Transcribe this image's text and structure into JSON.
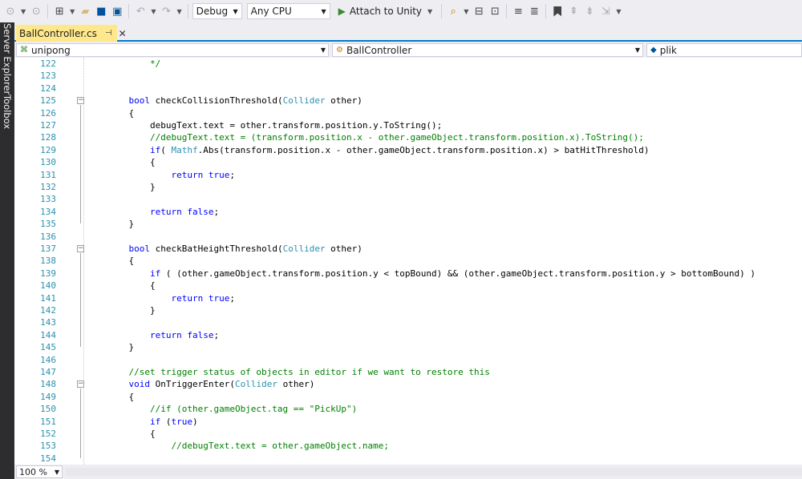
{
  "toolbar": {
    "back_icon": "back-arrow-icon",
    "config": "Debug",
    "platform": "Any CPU",
    "attach_label": "Attach to Unity"
  },
  "sidebar": {
    "server_explorer": "Server Explorer",
    "toolbox": "Toolbox"
  },
  "tab": {
    "title": "BallController.cs",
    "pin": "⊣",
    "close": "✕"
  },
  "nav": {
    "project": "unipong",
    "class": "BallController",
    "member": "plik"
  },
  "zoom": "100 %",
  "colors": {
    "keyword": "#0000ff",
    "type": "#2b91af",
    "comment": "#008000",
    "string": "#a31515",
    "line_number": "#2b91af",
    "active_tab": "#ffe88c",
    "accent": "#007acc"
  },
  "code_lines": [
    {
      "n": "122",
      "tokens": [
        [
          "        */",
          "c"
        ]
      ]
    },
    {
      "n": "123",
      "tokens": []
    },
    {
      "n": "124",
      "tokens": []
    },
    {
      "n": "125",
      "fold": "−",
      "tokens": [
        [
          "    ",
          ""
        ],
        [
          "bool",
          "k"
        ],
        [
          " checkCollisionThreshold(",
          ""
        ],
        [
          "Collider",
          "t"
        ],
        [
          " other)",
          ""
        ]
      ]
    },
    {
      "n": "126",
      "tokens": [
        [
          "    {",
          ""
        ]
      ]
    },
    {
      "n": "127",
      "tokens": [
        [
          "        debugText.text = other.transform.position.y.ToString();",
          ""
        ]
      ]
    },
    {
      "n": "128",
      "tokens": [
        [
          "        //debugText.text = (transform.position.x - other.gameObject.transform.position.x).ToString();",
          "c"
        ]
      ]
    },
    {
      "n": "129",
      "tokens": [
        [
          "        ",
          ""
        ],
        [
          "if",
          "k"
        ],
        [
          "( ",
          ""
        ],
        [
          "Mathf",
          "t"
        ],
        [
          ".Abs(transform.position.x - other.gameObject.transform.position.x) > batHitThreshold)",
          ""
        ]
      ]
    },
    {
      "n": "130",
      "tokens": [
        [
          "        {",
          ""
        ]
      ]
    },
    {
      "n": "131",
      "tokens": [
        [
          "            ",
          ""
        ],
        [
          "return",
          "k"
        ],
        [
          " ",
          ""
        ],
        [
          "true",
          "k"
        ],
        [
          ";",
          ""
        ]
      ]
    },
    {
      "n": "132",
      "tokens": [
        [
          "        }",
          ""
        ]
      ]
    },
    {
      "n": "133",
      "tokens": []
    },
    {
      "n": "134",
      "tokens": [
        [
          "        ",
          ""
        ],
        [
          "return",
          "k"
        ],
        [
          " ",
          ""
        ],
        [
          "false",
          "k"
        ],
        [
          ";",
          ""
        ]
      ]
    },
    {
      "n": "135",
      "tokens": [
        [
          "    }",
          ""
        ]
      ]
    },
    {
      "n": "136",
      "tokens": []
    },
    {
      "n": "137",
      "fold": "−",
      "tokens": [
        [
          "    ",
          ""
        ],
        [
          "bool",
          "k"
        ],
        [
          " checkBatHeightThreshold(",
          ""
        ],
        [
          "Collider",
          "t"
        ],
        [
          " other)",
          ""
        ]
      ]
    },
    {
      "n": "138",
      "tokens": [
        [
          "    {",
          ""
        ]
      ]
    },
    {
      "n": "139",
      "tokens": [
        [
          "        ",
          ""
        ],
        [
          "if",
          "k"
        ],
        [
          " ( (other.gameObject.transform.position.y < topBound) && (other.gameObject.transform.position.y > bottomBound) )",
          ""
        ]
      ]
    },
    {
      "n": "140",
      "tokens": [
        [
          "        {",
          ""
        ]
      ]
    },
    {
      "n": "141",
      "tokens": [
        [
          "            ",
          ""
        ],
        [
          "return",
          "k"
        ],
        [
          " ",
          ""
        ],
        [
          "true",
          "k"
        ],
        [
          ";",
          ""
        ]
      ]
    },
    {
      "n": "142",
      "tokens": [
        [
          "        }",
          ""
        ]
      ]
    },
    {
      "n": "143",
      "tokens": []
    },
    {
      "n": "144",
      "tokens": [
        [
          "        ",
          ""
        ],
        [
          "return",
          "k"
        ],
        [
          " ",
          ""
        ],
        [
          "false",
          "k"
        ],
        [
          ";",
          ""
        ]
      ]
    },
    {
      "n": "145",
      "tokens": [
        [
          "    }",
          ""
        ]
      ]
    },
    {
      "n": "146",
      "tokens": []
    },
    {
      "n": "147",
      "tokens": [
        [
          "    //set trigger status of objects in editor if we want to restore this",
          "c"
        ]
      ]
    },
    {
      "n": "148",
      "fold": "−",
      "tokens": [
        [
          "    ",
          ""
        ],
        [
          "void",
          "k"
        ],
        [
          " OnTriggerEnter(",
          ""
        ],
        [
          "Collider",
          "t"
        ],
        [
          " other)",
          ""
        ]
      ]
    },
    {
      "n": "149",
      "tokens": [
        [
          "    {",
          ""
        ]
      ]
    },
    {
      "n": "150",
      "tokens": [
        [
          "        //if (other.gameObject.tag == \"PickUp\")",
          "c"
        ]
      ]
    },
    {
      "n": "151",
      "tokens": [
        [
          "        ",
          ""
        ],
        [
          "if",
          "k"
        ],
        [
          " (",
          ""
        ],
        [
          "true",
          "k"
        ],
        [
          ")",
          ""
        ]
      ]
    },
    {
      "n": "152",
      "tokens": [
        [
          "        {",
          ""
        ]
      ]
    },
    {
      "n": "153",
      "tokens": [
        [
          "            //debugText.text = other.gameObject.name;",
          "c"
        ]
      ]
    },
    {
      "n": "154",
      "tokens": []
    }
  ]
}
